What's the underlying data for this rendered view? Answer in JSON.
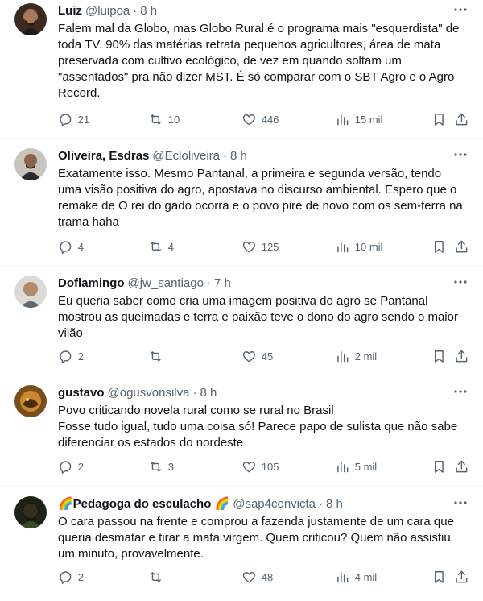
{
  "colors": {
    "text": "#0f1419",
    "secondary": "#536471",
    "divider": "#eff3f4"
  },
  "icons": {
    "more": "more-horizontal-icon",
    "reply": "reply-icon",
    "retweet": "retweet-icon",
    "like": "heart-icon",
    "views": "views-chart-icon",
    "bookmark": "bookmark-icon",
    "share": "share-icon"
  },
  "tweets": [
    {
      "name": "Luiz",
      "handle": "@luipoa",
      "dot": "·",
      "time": "8 h",
      "text": "Falem mal da Globo, mas Globo Rural é o programa mais \"esquerdista\" de\ntoda TV. 90% das matérias retrata pequenos agricultores, área de mata\npreservada com cultivo ecológico, de vez em quando soltam um\n\"assentados\" pra não dizer MST. É só comparar com o SBT Agro e o Agro\nRecord.",
      "replies": "21",
      "retweets": "10",
      "likes": "446",
      "views": "15 mil"
    },
    {
      "name": "Oliveira, Esdras",
      "handle": "@Ecloliveira",
      "dot": "·",
      "time": "8 h",
      "text": "Exatamente isso. Mesmo Pantanal, a primeira e segunda versão, tendo\numa visão positiva do agro, apostava no discurso ambiental. Espero que o\nremake de O rei do gado ocorra e o povo pire de novo com os sem-terra na\ntrama haha",
      "replies": "4",
      "retweets": "4",
      "likes": "125",
      "views": "10 mil"
    },
    {
      "name": "Doflamingo",
      "handle": "@jw_santiago",
      "dot": "·",
      "time": "7 h",
      "text": "Eu queria saber como cria uma imagem positiva do agro se Pantanal\nmostrou as queimadas e terra e paixão teve o dono do agro sendo o maior\nvilão",
      "replies": "2",
      "retweets": "",
      "likes": "45",
      "views": "2 mil"
    },
    {
      "name": "gustavo",
      "handle": "@ogusvonsilva",
      "dot": "·",
      "time": "8 h",
      "text": "Povo criticando novela rural como se rural no Brasil\nFosse tudo igual, tudo uma coisa só! Parece papo de sulista que não sabe\ndiferenciar os estados do nordeste",
      "replies": "2",
      "retweets": "3",
      "likes": "105",
      "views": "5 mil"
    },
    {
      "name": "🌈Pedagoga do esculacho 🌈",
      "handle": "@sap4convicta",
      "dot": "·",
      "time": "8 h",
      "text": "O cara passou na frente e comprou a fazenda justamente de um cara que\nqueria desmatar e tirar a mata virgem. Quem criticou? Quem não assistiu\num minuto, provavelmente.",
      "replies": "2",
      "retweets": "",
      "likes": "48",
      "views": "4 mil"
    }
  ]
}
